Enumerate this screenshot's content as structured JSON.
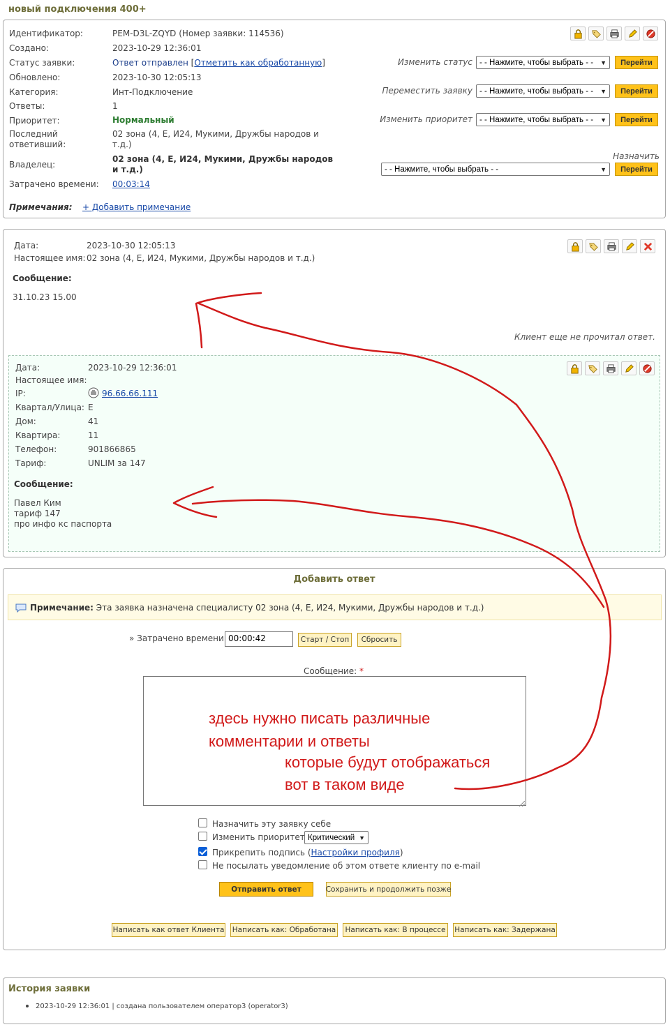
{
  "page_title": "новый подключения 400+",
  "ticket": {
    "labels": {
      "id": "Идентификатор:",
      "created": "Создано:",
      "status": "Статус заявки:",
      "updated": "Обновлено:",
      "category": "Категория:",
      "replies": "Ответы:",
      "priority": "Приоритет:",
      "last_replier": "Последний ответивший:",
      "owner": "Владелец:",
      "time_spent": "Затрачено времени:",
      "notes": "Примечания:"
    },
    "id_value": "PEM-D3L-ZQYD (Номер заявки: 114536)",
    "created": "2023-10-29 12:36:01",
    "status_value": "Ответ отправлен",
    "status_link_open": "[",
    "mark_processed_link": "Отметить как обработанную",
    "status_link_close": "]",
    "updated": "2023-10-30 12:05:13",
    "category": "Инт-Подключение",
    "replies": "1",
    "priority": "Нормальный",
    "last_replier": "02 зона (4, Е, И24, Мукими, Дружбы народов и т.д.)",
    "owner": "02 зона (4, Е, И24, Мукими, Дружбы народов и т.д.)",
    "time_spent": "00:03:14",
    "add_note": "+ Добавить примечание",
    "controls": {
      "change_status": "Изменить статус",
      "move_ticket": "Переместить заявку",
      "change_priority": "Изменить приоритет",
      "assign": "Назначить",
      "select_placeholder": "- - Нажмите, чтобы выбрать - -",
      "go": "Перейти"
    }
  },
  "reply1": {
    "date_label": "Дата:",
    "date": "2023-10-30 12:05:13",
    "name_label": "Настоящее имя:",
    "name": "02 зона (4, Е, И24, Мукими, Дружбы народов и т.д.)",
    "message_label": "Сообщение:",
    "message": "31.10.23 15.00",
    "unread": "Клиент еще не прочитал ответ."
  },
  "request": {
    "date_label": "Дата:",
    "date": "2023-10-29 12:36:01",
    "name_label": "Настоящее имя:",
    "ip_label": "IP:",
    "ip": "96.66.66.111",
    "street_label": "Квартал/Улица:",
    "street": "Е",
    "house_label": "Дом:",
    "house": "41",
    "flat_label": "Квартира:",
    "flat": "11",
    "phone_label": "Телефон:",
    "phone": "901866865",
    "tariff_label": "Тариф:",
    "tariff": "UNLIM за 147",
    "message_label": "Сообщение:",
    "message_lines": [
      "Павел Ким",
      "тариф 147",
      "про инфо кс паспорта"
    ]
  },
  "add_reply": {
    "title": "Добавить ответ",
    "note_label": "Примечание:",
    "note_text": "Эта заявка назначена специалисту 02 зона (4, Е, И24, Мукими, Дружбы народов и т.д.)",
    "time_label": "» Затрачено времени",
    "time_value": "00:00:42",
    "start_stop": "Старт / Стоп",
    "reset": "Сбросить",
    "message_label": "Сообщение:",
    "required_mark": "*",
    "assign_self": "Назначить эту заявку себе",
    "change_priority": "Изменить приоритет",
    "priority_option": "Критический",
    "attach_signature": "Прикрепить подпись (",
    "profile_settings": "Настройки профиля",
    "close_paren": ")",
    "no_email": "Не посылать уведомление об этом ответе клиенту по e-mail",
    "submit": "Отправить ответ",
    "save_later": "Сохранить и продолжить позже",
    "write_client": "Написать как ответ Клиента",
    "write_processed": "Написать как: Обработана",
    "write_inprogress": "Написать как: В процессе",
    "write_delayed": "Написать как: Задержана"
  },
  "annotation": {
    "line1": "здесь нужно писать различные",
    "line2": "комментарии и ответы",
    "line3": "которые будут отображаться",
    "line4": "вот в таком виде"
  },
  "history": {
    "title": "История заявки",
    "items": [
      "2023-10-29 12:36:01 | создана пользователем оператор3 (operator3)"
    ]
  },
  "colors": {
    "accent_button": "#ffc21a",
    "priority_green": "#2e7d32",
    "link": "#1a4aa8",
    "annotation_red": "#d11a1a",
    "request_bg": "#f5fff9",
    "note_bg": "#fffbe5"
  }
}
